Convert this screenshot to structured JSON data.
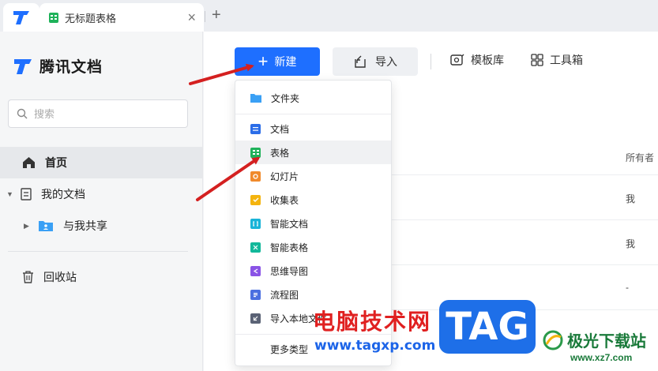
{
  "tabs": {
    "doc_tab_title": "无标题表格",
    "close_glyph": "×",
    "add_glyph": "+"
  },
  "sidebar": {
    "brand": "腾讯文档",
    "search_placeholder": "搜索",
    "items": [
      {
        "label": "首页"
      },
      {
        "label": "我的文档"
      },
      {
        "label": "与我共享"
      },
      {
        "label": "回收站"
      }
    ]
  },
  "toolbar": {
    "new_label": "新建",
    "import_label": "导入",
    "template_label": "模板库",
    "tools_label": "工具箱"
  },
  "list": {
    "owner_header": "所有者",
    "owners": [
      "我",
      "我",
      "-"
    ]
  },
  "new_menu": {
    "items": [
      {
        "label": "文件夹",
        "icon": "folder-icon",
        "color": "#3aa0f5"
      },
      {
        "label": "文档",
        "icon": "doc-icon",
        "color": "#2b6de8"
      },
      {
        "label": "表格",
        "icon": "sheet-icon",
        "color": "#1fb25a"
      },
      {
        "label": "幻灯片",
        "icon": "slide-icon",
        "color": "#f08a2c"
      },
      {
        "label": "收集表",
        "icon": "form-icon",
        "color": "#f4b40f"
      },
      {
        "label": "智能文档",
        "icon": "smart-doc-icon",
        "color": "#1ab4d8"
      },
      {
        "label": "智能表格",
        "icon": "smart-sheet-icon",
        "color": "#12b89a"
      },
      {
        "label": "思维导图",
        "icon": "mindmap-icon",
        "color": "#8a54e6"
      },
      {
        "label": "流程图",
        "icon": "flowchart-icon",
        "color": "#4b6fe0"
      },
      {
        "label": "导入本地文件",
        "icon": "import-local-icon",
        "color": "#5a6275"
      },
      {
        "label": "更多类型"
      }
    ]
  },
  "watermark": {
    "site_name": "电脑技术网",
    "url": "www.tagxp.com",
    "tag": "TAG",
    "logo_text": "极光下载站",
    "logo_url": "www.xz7.com"
  },
  "colors": {
    "accent": "#1e6fff",
    "arrow": "#d42020"
  }
}
